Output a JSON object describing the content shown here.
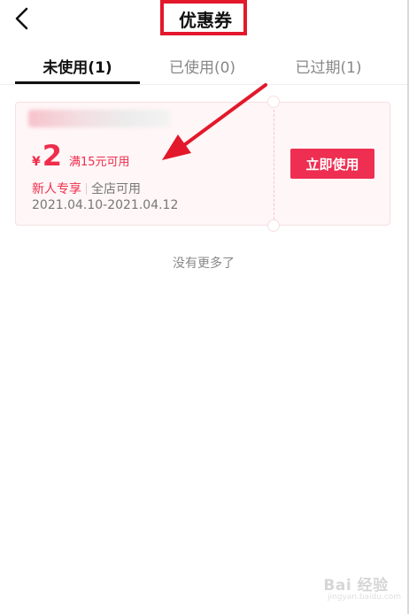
{
  "header": {
    "title": "优惠券",
    "back_icon": "chevron-left-icon"
  },
  "tabs": [
    {
      "label": "未使用(1)",
      "active": true
    },
    {
      "label": "已使用(0)",
      "active": false
    },
    {
      "label": "已过期(1)",
      "active": false
    }
  ],
  "coupon": {
    "currency": "¥",
    "amount": "2",
    "condition": "满15元可用",
    "tag": "新人专享",
    "scope": "全店可用",
    "validity": "2021.04.10-2021.04.12",
    "button_label": "立即使用"
  },
  "footer": {
    "no_more": "没有更多了"
  },
  "watermark": {
    "text": "Bai 经验",
    "sub": "jingyan.baidu.com"
  },
  "colors": {
    "accent": "#ee2f52",
    "highlight": "#e3182b",
    "card_bg": "#fff6f7"
  }
}
